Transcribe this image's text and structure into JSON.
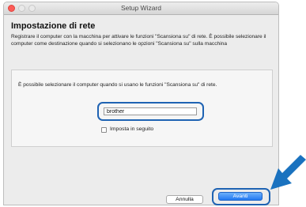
{
  "window": {
    "title": "Setup Wizard"
  },
  "page": {
    "heading": "Impostazione di rete",
    "description": "Registrare il computer con la macchina per attivare le funzioni \"Scansiona su\" di rete. È possibile selezionare il computer come destinazione quando si selezionano le opzioni \"Scansiona su\" sulla macchina",
    "panel_text": "È possibile selezionare il computer quando si usano le funzioni \"Scansiona su\" di rete.",
    "computer_name": "brother",
    "set_later_label": "Imposta in seguito",
    "set_later_checked": false
  },
  "buttons": {
    "cancel": "Annulla",
    "next": "Avanti"
  },
  "colors": {
    "highlight": "#1f63b3",
    "pointer_arrow": "#1a72bf",
    "primary_button": "#2379f1"
  },
  "icons": {
    "pointer": "pointer-arrow-icon"
  }
}
